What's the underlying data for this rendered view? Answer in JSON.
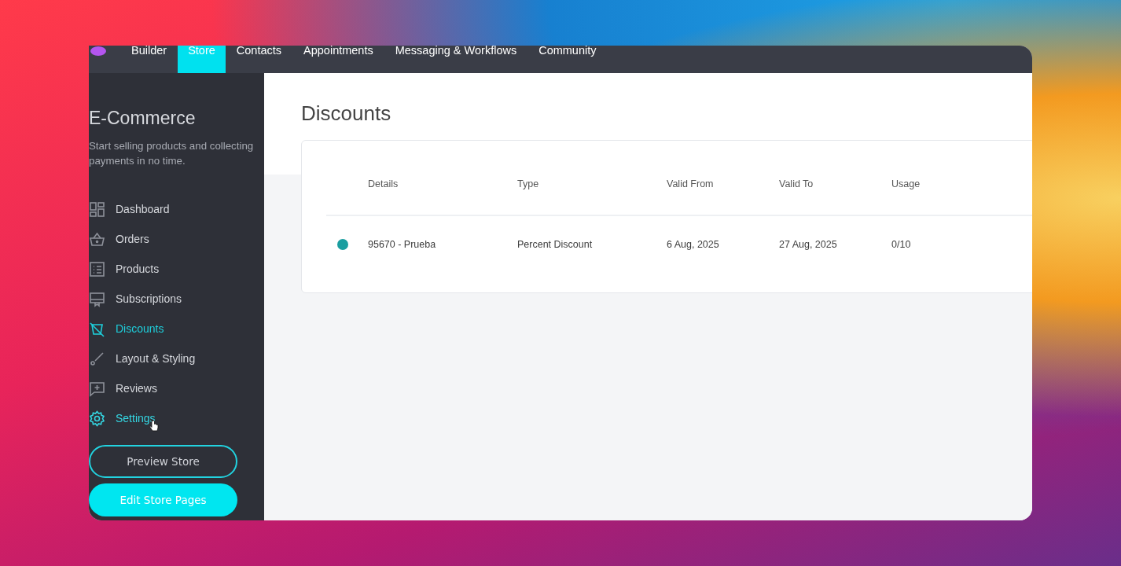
{
  "top_nav": {
    "items": [
      {
        "label": "Builder",
        "selected": false
      },
      {
        "label": "Store",
        "selected": true
      },
      {
        "label": "Contacts",
        "selected": false
      },
      {
        "label": "Appointments",
        "selected": false
      },
      {
        "label": "Messaging & Workflows",
        "selected": false
      },
      {
        "label": "Community",
        "selected": false
      }
    ]
  },
  "sidebar": {
    "title": "E-Commerce",
    "subtitle": "Start selling products and collecting payments in no time.",
    "items": [
      {
        "label": "Dashboard",
        "selected": false,
        "hovered": false
      },
      {
        "label": "Orders",
        "selected": false,
        "hovered": false
      },
      {
        "label": "Products",
        "selected": false,
        "hovered": false
      },
      {
        "label": "Subscriptions",
        "selected": false,
        "hovered": false
      },
      {
        "label": "Discounts",
        "selected": true,
        "hovered": false
      },
      {
        "label": "Layout & Styling",
        "selected": false,
        "hovered": false
      },
      {
        "label": "Reviews",
        "selected": false,
        "hovered": false
      },
      {
        "label": "Settings",
        "selected": false,
        "hovered": true
      }
    ],
    "buttons": [
      {
        "label": "Preview Store",
        "kind": "outline"
      },
      {
        "label": "Edit Store Pages",
        "kind": "filled"
      }
    ]
  },
  "page": {
    "title": "Discounts",
    "table": {
      "columns": [
        "Details",
        "Type",
        "Valid From",
        "Valid To",
        "Usage"
      ],
      "rows": [
        {
          "color": "#1a9ea0",
          "cells": [
            "95670 - Prueba",
            "Percent Discount",
            "6 Aug, 2025",
            "27 Aug, 2025",
            "0/10"
          ]
        }
      ]
    }
  }
}
